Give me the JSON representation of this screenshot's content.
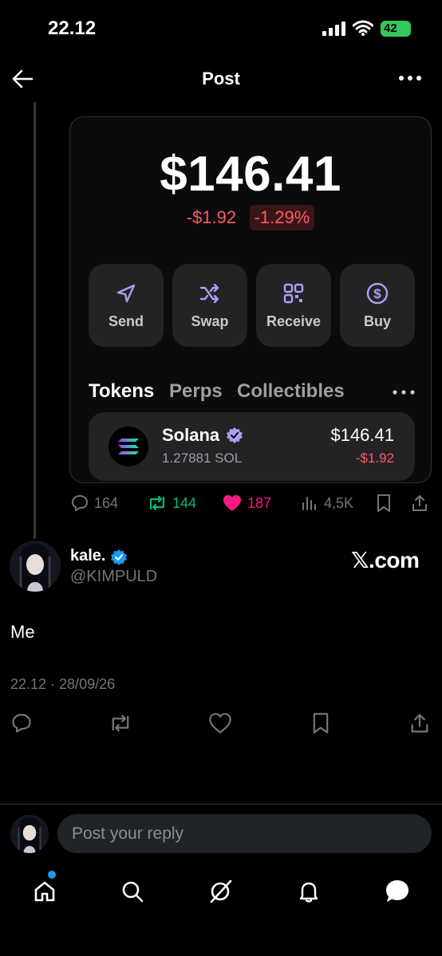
{
  "status_bar": {
    "time": "22.12",
    "battery": "42"
  },
  "header": {
    "title": "Post"
  },
  "embedded_card": {
    "balance": "$146.41",
    "change_abs": "-$1.92",
    "change_pct": "-1.29%",
    "actions": [
      {
        "label": "Send",
        "icon": "send-icon"
      },
      {
        "label": "Swap",
        "icon": "shuffle-icon"
      },
      {
        "label": "Receive",
        "icon": "qr-code-icon"
      },
      {
        "label": "Buy",
        "icon": "dollar-circle-icon"
      }
    ],
    "tabs": [
      "Tokens",
      "Perps",
      "Collectibles"
    ],
    "token": {
      "name": "Solana",
      "amount": "1.27881 SOL",
      "value": "$146.41",
      "change": "-$1.92"
    }
  },
  "engagement": {
    "replies": "164",
    "reposts": "144",
    "likes": "187",
    "views": "4,5K"
  },
  "tweet": {
    "author_name": "kale.",
    "handle": "@KIMPULD",
    "source_label": "𝕏.com",
    "text": "Me",
    "timestamp": "22.12 · 28/09/26"
  },
  "reply": {
    "placeholder": "Post your reply"
  },
  "colors": {
    "accent": "#1d9bf0",
    "like": "#f91880",
    "repost": "#00ba7c",
    "negative": "#ff5963",
    "wallet_icon": "#ab9ff2"
  }
}
